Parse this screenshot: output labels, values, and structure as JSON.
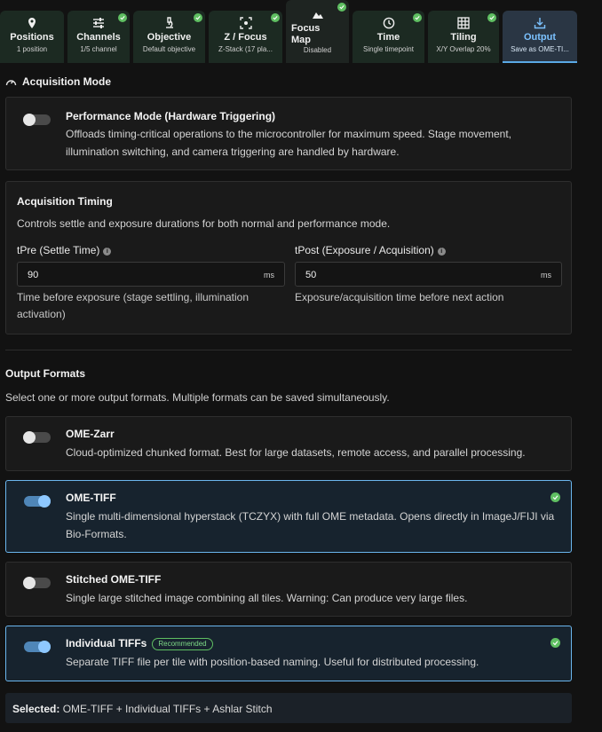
{
  "tabs": [
    {
      "label": "Positions",
      "sub": "1 position",
      "icon": "map-pin-icon",
      "done": false
    },
    {
      "label": "Channels",
      "sub": "1/5 channel",
      "icon": "sliders-icon",
      "done": true
    },
    {
      "label": "Objective",
      "sub": "Default objective",
      "icon": "microscope-icon",
      "done": true
    },
    {
      "label": "Z / Focus",
      "sub": "Z-Stack (17 pla...",
      "icon": "focus-target-icon",
      "done": true
    },
    {
      "label": "Focus Map",
      "sub": "Disabled",
      "icon": "mountain-icon",
      "done": true
    },
    {
      "label": "Time",
      "sub": "Single timepoint",
      "icon": "clock-icon",
      "done": true
    },
    {
      "label": "Tiling",
      "sub": "X/Y Overlap 20%",
      "icon": "grid-icon",
      "done": true
    },
    {
      "label": "Output",
      "sub": "Save as OME-TI...",
      "icon": "download-icon",
      "done": false
    }
  ],
  "acq": {
    "heading": "Acquisition Mode",
    "perf_title": "Performance Mode (Hardware Triggering)",
    "perf_desc": "Offloads timing-critical operations to the microcontroller for maximum speed. Stage movement, illumination switching, and camera triggering are handled by hardware.",
    "perf_on": false
  },
  "timing": {
    "title": "Acquisition Timing",
    "desc": "Controls settle and exposure durations for both normal and performance mode.",
    "tpre_label": "tPre (Settle Time)",
    "tpre_value": "90",
    "tpre_unit": "ms",
    "tpre_hint": "Time before exposure (stage settling, illumination activation)",
    "tpost_label": "tPost (Exposure / Acquisition)",
    "tpost_value": "50",
    "tpost_unit": "ms",
    "tpost_hint": "Exposure/acquisition time before next action"
  },
  "output": {
    "heading": "Output Formats",
    "desc": "Select one or more output formats. Multiple formats can be saved simultaneously.",
    "formats": [
      {
        "title": "OME-Zarr",
        "desc": "Cloud-optimized chunked format. Best for large datasets, remote access, and parallel processing.",
        "on": false
      },
      {
        "title": "OME-TIFF",
        "desc": "Single multi-dimensional hyperstack (TCZYX) with full OME metadata. Opens directly in ImageJ/FIJI via Bio-Formats.",
        "on": true
      },
      {
        "title": "Stitched OME-TIFF",
        "desc": "Single large stitched image combining all tiles. Warning: Can produce very large files.",
        "on": false
      },
      {
        "title": "Individual TIFFs",
        "badge": "Recommended",
        "desc": "Separate TIFF file per tile with position-based naming. Useful for distributed processing.",
        "on": true
      }
    ],
    "selected_label": "Selected:",
    "selected_value": "OME-TIFF + Individual TIFFs + Ashlar Stitch"
  },
  "colors": {
    "accent": "#5aa9e6",
    "success": "#5fbf62",
    "bg": "#121212"
  }
}
